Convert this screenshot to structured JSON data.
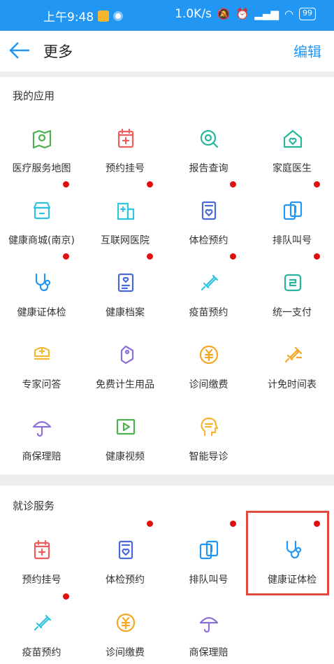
{
  "status_bar": {
    "time": "上午9:48",
    "network_speed": "1.0K/s",
    "battery": "99"
  },
  "header": {
    "title": "更多",
    "edit_label": "编辑"
  },
  "sections": [
    {
      "title": "我的应用",
      "items": [
        {
          "label": "医疗服务地图",
          "icon": "map-pin-icon",
          "color": "#4caf50",
          "dot": false
        },
        {
          "label": "预约挂号",
          "icon": "calendar-plus-icon",
          "color": "#f15c5c",
          "dot": false
        },
        {
          "label": "报告查询",
          "icon": "report-search-icon",
          "color": "#26b69b",
          "dot": false
        },
        {
          "label": "家庭医生",
          "icon": "house-heart-icon",
          "color": "#26b69b",
          "dot": false
        },
        {
          "label": "健康商城(南京)",
          "icon": "store-icon",
          "color": "#2ec4e0",
          "dot": true
        },
        {
          "label": "互联网医院",
          "icon": "hospital-icon",
          "color": "#2ec4e0",
          "dot": true
        },
        {
          "label": "体检预约",
          "icon": "checkup-icon",
          "color": "#4a68d8",
          "dot": true
        },
        {
          "label": "排队叫号",
          "icon": "queue-number-icon",
          "color": "#2196f3",
          "dot": true
        },
        {
          "label": "健康证体检",
          "icon": "stethoscope-icon",
          "color": "#2196f3",
          "dot": true
        },
        {
          "label": "健康档案",
          "icon": "health-record-icon",
          "color": "#4a68d8",
          "dot": true
        },
        {
          "label": "疫苗预约",
          "icon": "syringe-icon",
          "color": "#2ec4e0",
          "dot": true
        },
        {
          "label": "统一支付",
          "icon": "payment-icon",
          "color": "#26b69b",
          "dot": true
        },
        {
          "label": "专家问答",
          "icon": "nurse-cap-icon",
          "color": "#f5b731",
          "dot": false
        },
        {
          "label": "免费计生用品",
          "icon": "tag-icon",
          "color": "#8a6fd8",
          "dot": false
        },
        {
          "label": "诊间缴费",
          "icon": "yuan-coin-icon",
          "color": "#f5a623",
          "dot": false
        },
        {
          "label": "计免时间表",
          "icon": "vaccine-schedule-icon",
          "color": "#f5a623",
          "dot": false
        },
        {
          "label": "商保理赔",
          "icon": "umbrella-icon",
          "color": "#8a6fd8",
          "dot": false
        },
        {
          "label": "健康视频",
          "icon": "video-play-icon",
          "color": "#4caf50",
          "dot": false
        },
        {
          "label": "智能导诊",
          "icon": "ai-head-icon",
          "color": "#f5b731",
          "dot": false
        }
      ]
    },
    {
      "title": "就诊服务",
      "items": [
        {
          "label": "预约挂号",
          "icon": "calendar-plus-icon",
          "color": "#f15c5c",
          "dot": false
        },
        {
          "label": "体检预约",
          "icon": "checkup-icon",
          "color": "#4a68d8",
          "dot": true
        },
        {
          "label": "排队叫号",
          "icon": "queue-number-icon",
          "color": "#2196f3",
          "dot": true
        },
        {
          "label": "健康证体检",
          "icon": "stethoscope-icon",
          "color": "#2196f3",
          "dot": true
        },
        {
          "label": "疫苗预约",
          "icon": "syringe-icon",
          "color": "#2ec4e0",
          "dot": true
        },
        {
          "label": "诊间缴费",
          "icon": "yuan-coin-icon",
          "color": "#f5a623",
          "dot": false
        },
        {
          "label": "商保理赔",
          "icon": "umbrella-icon",
          "color": "#8a6fd8",
          "dot": false
        }
      ]
    }
  ],
  "highlight_color": "#e04a3f"
}
